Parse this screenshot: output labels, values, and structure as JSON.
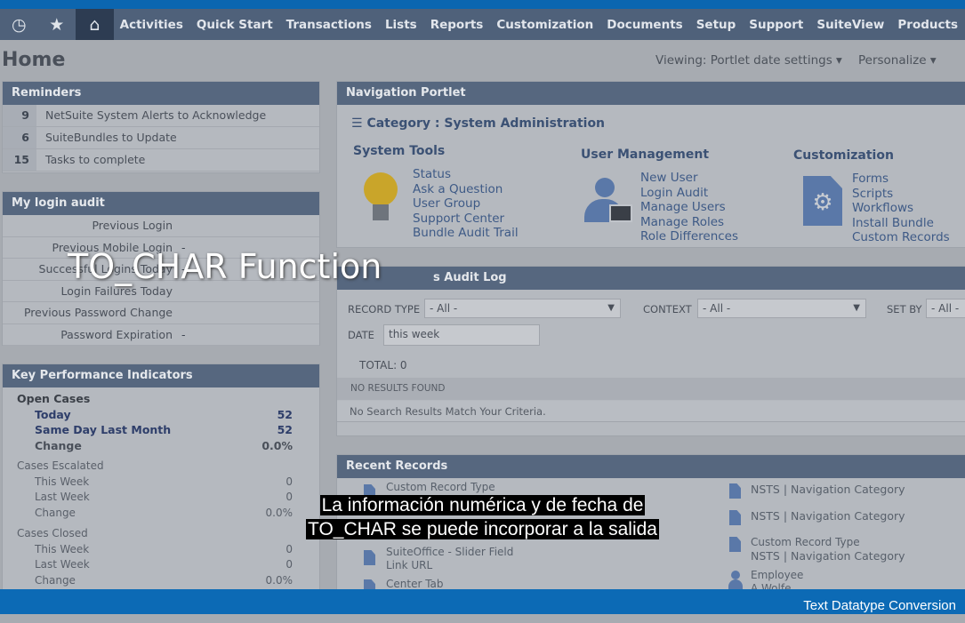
{
  "nav": {
    "icons": [
      "recent-icon",
      "star-icon",
      "home-icon"
    ],
    "items": [
      "Activities",
      "Quick Start",
      "Transactions",
      "Lists",
      "Reports",
      "Customization",
      "Documents",
      "Setup",
      "Support",
      "SuiteView",
      "Products"
    ]
  },
  "page": {
    "title": "Home",
    "viewing": "Viewing: Portlet date settings",
    "personalize": "Personalize"
  },
  "reminders": {
    "title": "Reminders",
    "items": [
      {
        "count": "9",
        "label": "NetSuite System Alerts to Acknowledge"
      },
      {
        "count": "6",
        "label": "SuiteBundles to Update"
      },
      {
        "count": "15",
        "label": "Tasks to complete"
      }
    ]
  },
  "login_audit": {
    "title": "My login audit",
    "rows": [
      {
        "label": "Previous Login",
        "value": ""
      },
      {
        "label": "Previous Mobile Login",
        "value": "-"
      },
      {
        "label": "Successful Logins Today",
        "value": "-"
      },
      {
        "label": "Login Failures Today",
        "value": ""
      },
      {
        "label": "Previous Password Change",
        "value": ""
      },
      {
        "label": "Password Expiration",
        "value": "-"
      }
    ]
  },
  "kpi": {
    "title": "Key Performance Indicators",
    "groups": [
      {
        "name": "Open Cases",
        "rows": [
          {
            "label": "Today",
            "value": "52"
          },
          {
            "label": "Same Day Last Month",
            "value": "52"
          },
          {
            "label": "Change",
            "value": "0.0%"
          }
        ]
      },
      {
        "name": "Cases Escalated",
        "rows": [
          {
            "label": "This Week",
            "value": "0"
          },
          {
            "label": "Last Week",
            "value": "0"
          },
          {
            "label": "Change",
            "value": "0.0%"
          }
        ]
      },
      {
        "name": "Cases Closed",
        "rows": [
          {
            "label": "This Week",
            "value": "0"
          },
          {
            "label": "Last Week",
            "value": "0"
          },
          {
            "label": "Change",
            "value": "0.0%"
          }
        ]
      }
    ]
  },
  "nav_portlet": {
    "title": "Navigation Portlet",
    "category": "Category :",
    "category_value": "System Administration",
    "system_tools": {
      "title": "System Tools",
      "links": [
        "Status",
        "Ask a Question",
        "User Group",
        "Support Center",
        "Bundle Audit Trail"
      ]
    },
    "user_management": {
      "title": "User Management",
      "links": [
        "New User",
        "Login Audit",
        "Manage Users",
        "Manage Roles",
        "Role Differences"
      ]
    },
    "customization": {
      "title": "Customization",
      "links": [
        "Forms",
        "Scripts",
        "Workflows",
        "Install Bundle",
        "Custom Records"
      ]
    }
  },
  "audit_log": {
    "title": "s Audit Log",
    "record_type_label": "RECORD TYPE",
    "record_type": "- All -",
    "context_label": "CONTEXT",
    "context": "- All -",
    "set_by_label": "SET BY",
    "set_by": "- All -",
    "date_label": "DATE",
    "date": "this week",
    "total": "TOTAL: 0",
    "no_results": "NO RESULTS FOUND",
    "no_match": "No Search Results Match Your Criteria."
  },
  "recent": {
    "title": "Recent Records",
    "left": [
      [
        "Custom Record Type",
        ""
      ],
      [
        "SuiteOffice - Slider Field",
        "Link URL"
      ],
      [
        "Center Tab",
        ""
      ]
    ],
    "right": [
      [
        "NSTS | Navigation Category",
        ""
      ],
      [
        "NSTS | Navigation Category",
        ""
      ],
      [
        "Custom Record Type",
        "NSTS | Navigation Category"
      ],
      [
        "Employee",
        "A Wolfe"
      ]
    ]
  },
  "overlay": {
    "title": "TO_CHAR Function",
    "caption_line1": "La información numérica y de fecha de",
    "caption_line2": "TO_CHAR se puede incorporar a la salida",
    "footer": "Text Datatype Conversion"
  }
}
